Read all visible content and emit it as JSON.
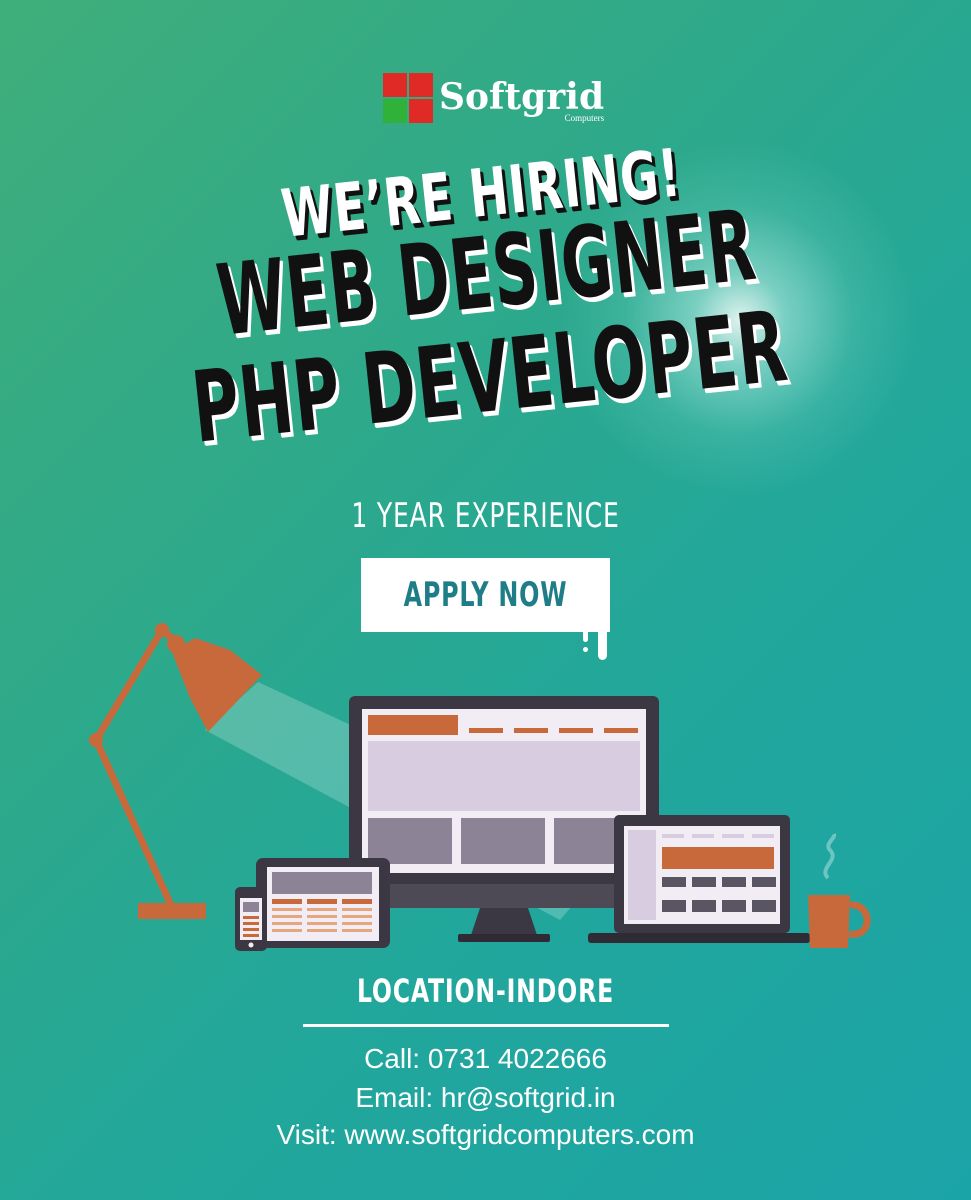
{
  "logo": {
    "name": "Softgrid",
    "sub": "Computers"
  },
  "headline": {
    "line1": "WE’RE HIRING!",
    "line2": "WEB DESIGNER",
    "line3": "PHP DEVELOPER"
  },
  "experience": "1 YEAR  EXPERIENCE",
  "cta": {
    "label": "APPLY NOW"
  },
  "location": "LOCATION-INDORE",
  "contact": {
    "call": "Call: 0731 4022666",
    "email": "Email: hr@softgrid.in",
    "visit": "Visit: www.softgridcomputers.com"
  },
  "colors": {
    "accent_orange": "#c8693c",
    "screen_lavender": "#d8cce0",
    "device_dark": "#3b3843",
    "cta_text": "#1e7d86",
    "logo_red": "#e02a25",
    "logo_green": "#2fb13a"
  },
  "icons": [
    "desk-lamp-icon",
    "desktop-monitor-icon",
    "laptop-icon",
    "tablet-icon",
    "phone-icon",
    "coffee-mug-icon"
  ]
}
